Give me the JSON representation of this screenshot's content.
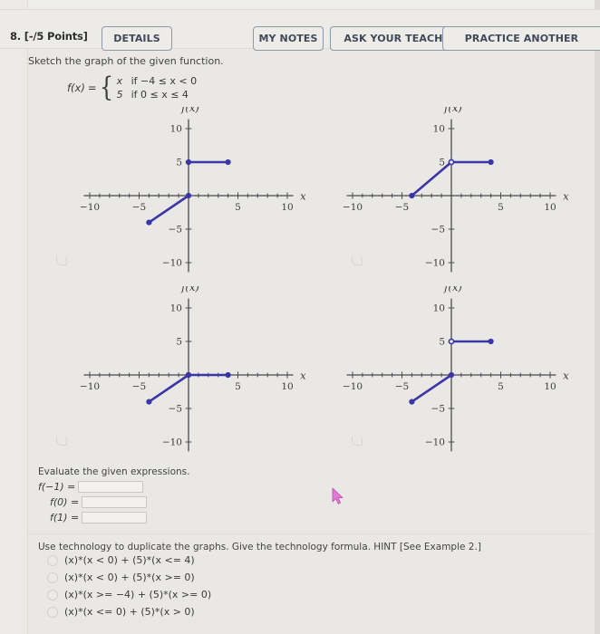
{
  "header": {
    "question_number": "8.",
    "points": "[-/5 Points]",
    "details_label": "DETAILS",
    "my_notes_label": "MY NOTES",
    "ask_teacher_label": "ASK YOUR TEACHER",
    "practice_another_label": "PRACTICE ANOTHER"
  },
  "prompt": "Sketch the graph of the given function.",
  "function": {
    "name": "f(x)",
    "equals": "=",
    "cases": [
      {
        "value": "x",
        "condition": "if −4 ≤ x < 0"
      },
      {
        "value": "5",
        "condition": "if 0 ≤ x ≤ 4"
      }
    ]
  },
  "graphs": [
    {
      "id": "graph-0",
      "ylabel": "f(x)",
      "xlabel": "x",
      "x_ticks": [
        "−10",
        "−5",
        "5",
        "10"
      ],
      "y_ticks": [
        "10",
        "5",
        "−5",
        "−10"
      ],
      "segments": [
        {
          "x1": -4,
          "y1": -4,
          "x2": 0,
          "y2": 0,
          "start": "closed",
          "end": "closed"
        },
        {
          "x1": 0,
          "y1": 5,
          "x2": 4,
          "y2": 5,
          "start": "closed",
          "end": "closed"
        }
      ]
    },
    {
      "id": "graph-1",
      "ylabel": "f(x)",
      "xlabel": "x",
      "x_ticks": [
        "−10",
        "−5",
        "5",
        "10"
      ],
      "y_ticks": [
        "10",
        "5",
        "−5",
        "−10"
      ],
      "segments": [
        {
          "x1": -4,
          "y1": 0,
          "x2": 0,
          "y2": 5,
          "start": "closed",
          "end": "closed"
        },
        {
          "x1": 0,
          "y1": 5,
          "x2": 4,
          "y2": 5,
          "start": "open",
          "end": "closed"
        }
      ]
    },
    {
      "id": "graph-2",
      "ylabel": "f(x)",
      "xlabel": "x",
      "x_ticks": [
        "−10",
        "−5",
        "5",
        "10"
      ],
      "y_ticks": [
        "10",
        "5",
        "−5",
        "−10"
      ],
      "segments": [
        {
          "x1": -4,
          "y1": -4,
          "x2": 0,
          "y2": 0,
          "start": "closed",
          "end": "closed"
        },
        {
          "x1": 0,
          "y1": 0,
          "x2": 4,
          "y2": 0,
          "start": "closed",
          "end": "closed"
        }
      ]
    },
    {
      "id": "graph-3",
      "ylabel": "f(x)",
      "xlabel": "x",
      "x_ticks": [
        "−10",
        "−5",
        "5",
        "10"
      ],
      "y_ticks": [
        "10",
        "5",
        "−5",
        "−10"
      ],
      "segments": [
        {
          "x1": -4,
          "y1": -4,
          "x2": 0,
          "y2": 0,
          "start": "closed",
          "end": "closed"
        },
        {
          "x1": 0,
          "y1": 5,
          "x2": 4,
          "y2": 5,
          "start": "open",
          "end": "closed"
        }
      ]
    }
  ],
  "evaluate": {
    "title": "Evaluate the given expressions.",
    "rows": [
      {
        "label": "f(−1) =",
        "value": "",
        "placeholder": ""
      },
      {
        "label": "f(0) =",
        "value": "",
        "placeholder": ""
      },
      {
        "label": "f(1) =",
        "value": "",
        "placeholder": ""
      }
    ]
  },
  "technology": {
    "title": "Use technology to duplicate the graphs. Give the technology formula. HINT [See Example 2.]",
    "choices": [
      "(x)*(x < 0) + (5)*(x <= 4)",
      "(x)*(x < 0) + (5)*(x >= 0)",
      "(x)*(x >= −4) + (5)*(x >= 0)",
      "(x)*(x <= 0) + (5)*(x > 0)"
    ]
  },
  "colors": {
    "plot": "#3b36a8",
    "axis": "#4a4a52",
    "button_border": "#8e99a8",
    "button_text": "#3f4a59",
    "cursor": "#e27ad8",
    "page_background": "#e9e8e4"
  },
  "chart_data": {
    "type": "line",
    "title": "Piecewise function f(x) = x if -4 <= x < 0; 5 if 0 <= x <= 4",
    "xlabel": "x",
    "ylabel": "f(x)",
    "xlim": [
      -11,
      11
    ],
    "ylim": [
      -11,
      11
    ],
    "grid": false,
    "legend": "none",
    "panels": [
      {
        "name": "option-1",
        "series": [
          {
            "name": "ramp",
            "x": [
              -4,
              0
            ],
            "y": [
              -4,
              0
            ]
          },
          {
            "name": "constant",
            "x": [
              0,
              4
            ],
            "y": [
              5,
              5
            ]
          }
        ]
      },
      {
        "name": "option-2",
        "series": [
          {
            "name": "ramp",
            "x": [
              -4,
              0
            ],
            "y": [
              0,
              5
            ]
          },
          {
            "name": "constant",
            "x": [
              0,
              4
            ],
            "y": [
              5,
              5
            ]
          }
        ]
      },
      {
        "name": "option-3",
        "series": [
          {
            "name": "ramp",
            "x": [
              -4,
              0
            ],
            "y": [
              -4,
              0
            ]
          },
          {
            "name": "constant",
            "x": [
              0,
              4
            ],
            "y": [
              0,
              0
            ]
          }
        ]
      },
      {
        "name": "option-4",
        "series": [
          {
            "name": "ramp",
            "x": [
              -4,
              0
            ],
            "y": [
              -4,
              0
            ]
          },
          {
            "name": "constant",
            "x": [
              0,
              4
            ],
            "y": [
              5,
              5
            ]
          }
        ]
      }
    ]
  }
}
